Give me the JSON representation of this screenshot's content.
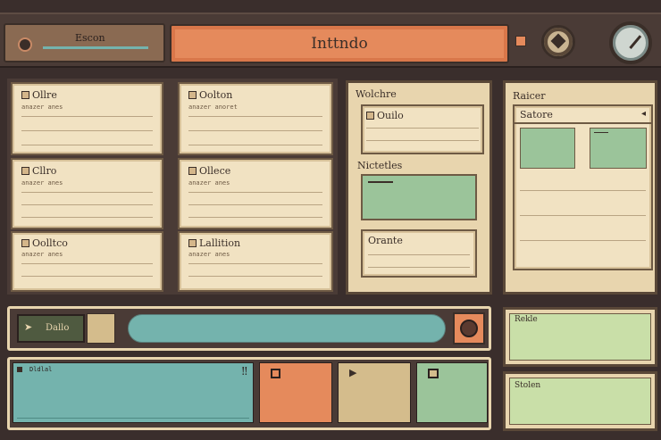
{
  "topbar": {
    "search_label": "Escon",
    "title": "Inttndo"
  },
  "cards": [
    {
      "title": "Ollre",
      "sub": "anazer anes"
    },
    {
      "title": "Oolton",
      "sub": "anazer anoret"
    },
    {
      "title": "Cllro",
      "sub": "anazer anes"
    },
    {
      "title": "Ollece",
      "sub": "anazer anes"
    },
    {
      "title": "Oolltco",
      "sub": "anazer anes"
    },
    {
      "title": "Lallition",
      "sub": "anazer anes"
    }
  ],
  "middle": {
    "heading": "Wolchre",
    "box1_title": "Ouilo",
    "section2": "Nictetles",
    "box3_title": "Orante"
  },
  "right": {
    "heading": "Raicer",
    "dropdown": "Satore"
  },
  "controls": {
    "button_label": "Dallo"
  },
  "bottom": {
    "teal_label": "Dldlal",
    "small_label_1": "Rekle",
    "small_label_2": "Stolen"
  },
  "colors": {
    "orange": "#e58a5c",
    "teal": "#74b3ad",
    "green": "#9bc49a",
    "tan": "#d4bc8c",
    "paper": "#f1e2c2",
    "dark": "#3a2e2c"
  }
}
